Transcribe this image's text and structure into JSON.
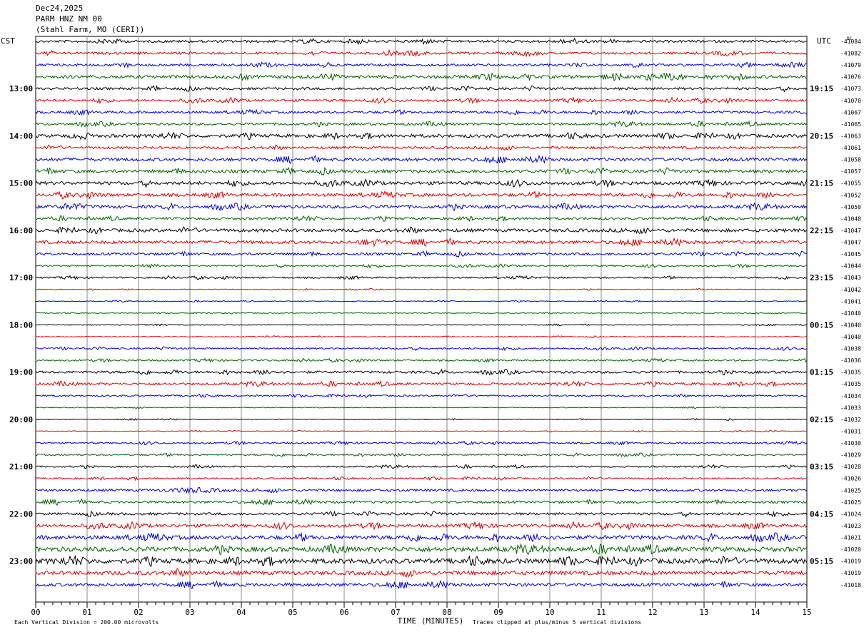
{
  "header": {
    "date": "Dec24,2025",
    "station": "PARM HNZ NM 00",
    "location": "(Stahl Farm, MO (CERI))"
  },
  "chart_data": {
    "type": "line",
    "title": "PARM HNZ NM 00",
    "left_axis_label": "CST",
    "right_axis_label": "UTC",
    "dc_label": "DC",
    "xlabel": "TIME (MINUTES)",
    "x_ticks": [
      "00",
      "01",
      "02",
      "03",
      "04",
      "05",
      "06",
      "07",
      "08",
      "09",
      "10",
      "11",
      "12",
      "13",
      "14",
      "15"
    ],
    "xlim": [
      0,
      15
    ],
    "left_time_labels": [
      "13:00",
      "14:00",
      "15:00",
      "16:00",
      "17:00",
      "18:00",
      "19:00",
      "20:00",
      "21:00",
      "22:00",
      "23:00"
    ],
    "right_time_labels": [
      "19:15",
      "20:15",
      "21:15",
      "22:15",
      "23:15",
      "00:15",
      "01:15",
      "02:15",
      "03:15",
      "04:15",
      "05:15"
    ],
    "trace_colors": [
      "#000000",
      "#e00000",
      "#0000e0",
      "#006400"
    ],
    "trace_count": 47,
    "dc_offsets": [
      "-41084",
      "-41082",
      "-41079",
      "-41076",
      "-41073",
      "-41070",
      "-41067",
      "-41065",
      "-41063",
      "-41061",
      "-41058",
      "-41057",
      "-41055",
      "-41052",
      "-41050",
      "-41048",
      "-41047",
      "-41047",
      "-41045",
      "-41044",
      "-41043",
      "-41042",
      "-41041",
      "-41040",
      "-41040",
      "-41040",
      "-41038",
      "-41036",
      "-41035",
      "-41035",
      "-41034",
      "-41033",
      "-41032",
      "-41031",
      "-41030",
      "-41029",
      "-41028",
      "-41026",
      "-41025",
      "-41025",
      "-41024",
      "-41023",
      "-41021",
      "-41020",
      "-41019",
      "-41019",
      "-41018",
      "-41016"
    ],
    "amplitude": [
      3,
      3,
      3,
      4,
      3,
      3,
      3,
      3,
      4,
      3,
      4,
      4,
      4,
      4,
      4,
      3,
      4,
      4,
      3,
      2,
      2,
      1,
      1,
      1,
      1,
      1,
      2,
      2,
      3,
      3,
      2,
      1,
      1,
      1,
      2,
      2,
      2,
      2,
      3,
      3,
      3,
      4,
      5,
      6,
      6,
      5,
      4,
      2
    ],
    "footer_left": "Each Vertical Division =  200.00 microvolts",
    "footer_right": "Traces clipped at plus/minus 5 vertical divisions"
  }
}
